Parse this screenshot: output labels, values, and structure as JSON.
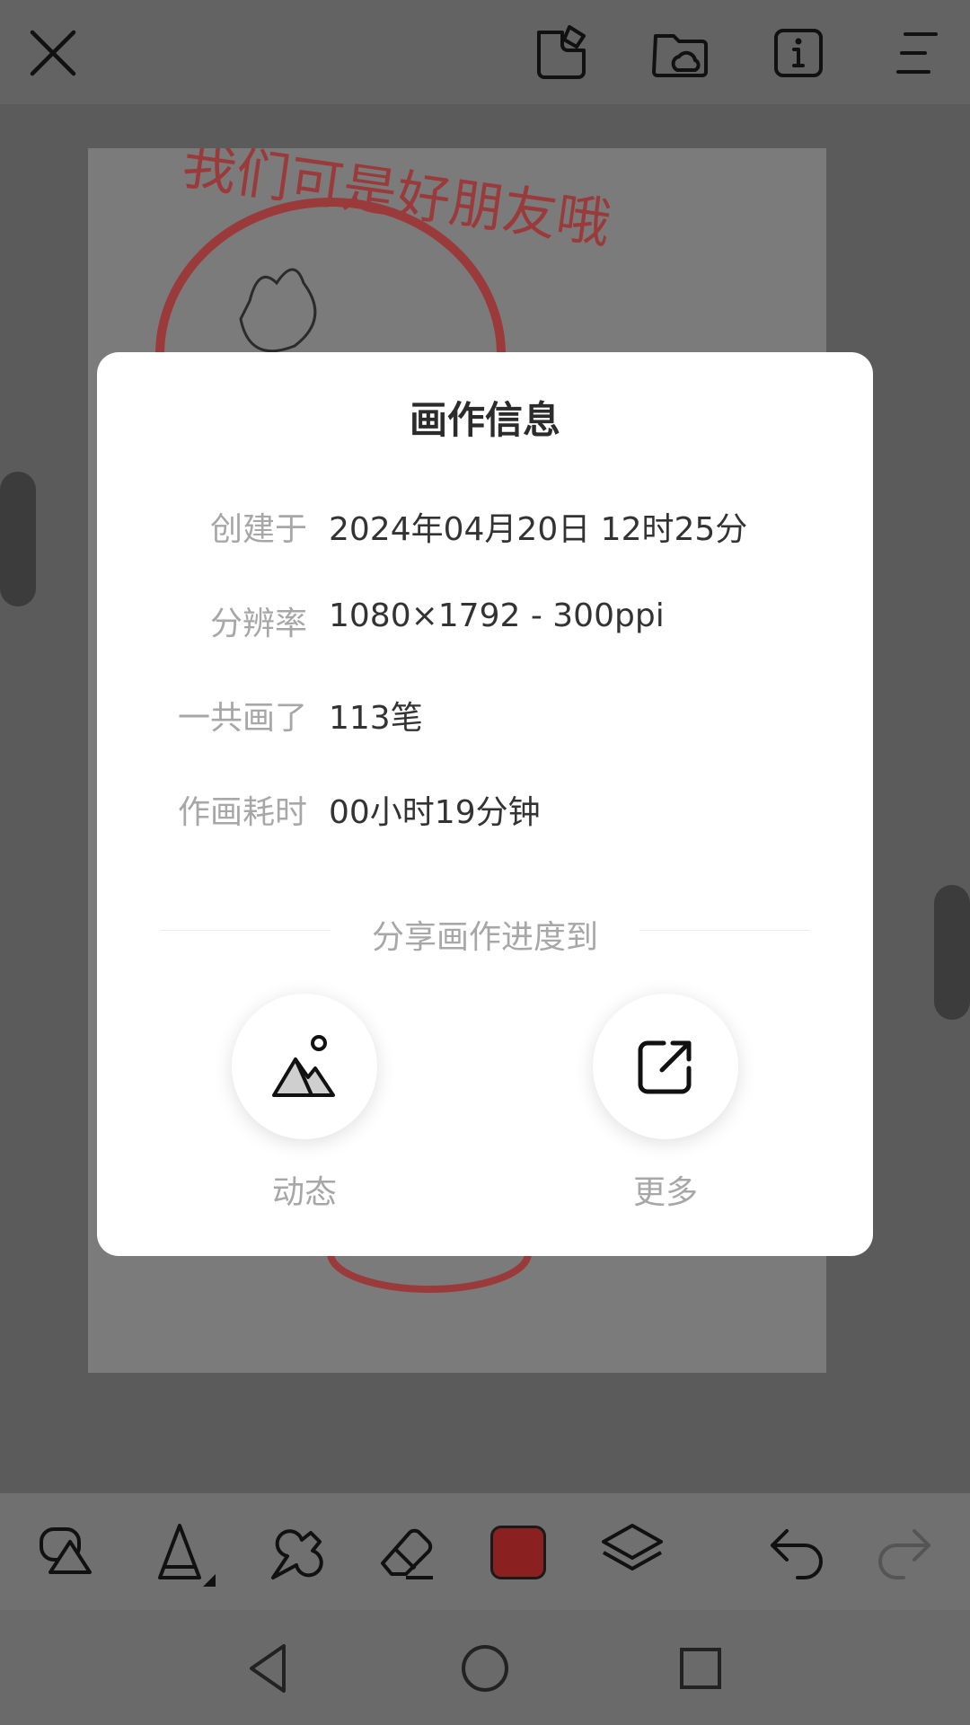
{
  "topbar": {
    "icons": [
      "close-icon",
      "card-icon",
      "cloud-folder-icon",
      "info-icon",
      "menu-icon"
    ]
  },
  "artwork": {
    "text": "我们可是好朋友哦"
  },
  "dialog": {
    "title": "画作信息",
    "rows": [
      {
        "label": "创建于",
        "value": "2024年04月20日 12时25分"
      },
      {
        "label": "分辨率",
        "value": "1080×1792 - 300ppi"
      },
      {
        "label": "一共画了",
        "value": "113笔"
      },
      {
        "label": "作画耗时",
        "value": "00小时19分钟"
      }
    ],
    "share_caption": "分享画作进度到",
    "share_targets": [
      {
        "label": "动态",
        "icon": "mountain-image-icon"
      },
      {
        "label": "更多",
        "icon": "share-external-icon"
      }
    ]
  },
  "toolbar": {
    "tools": [
      "shapes-icon",
      "pencil-icon",
      "smudge-icon",
      "eraser-icon",
      "color-swatch",
      "layers-icon",
      "undo-icon",
      "redo-icon"
    ],
    "current_color": "#8b2020"
  },
  "navbar": {
    "buttons": [
      "back-icon",
      "home-icon",
      "recents-icon"
    ]
  }
}
